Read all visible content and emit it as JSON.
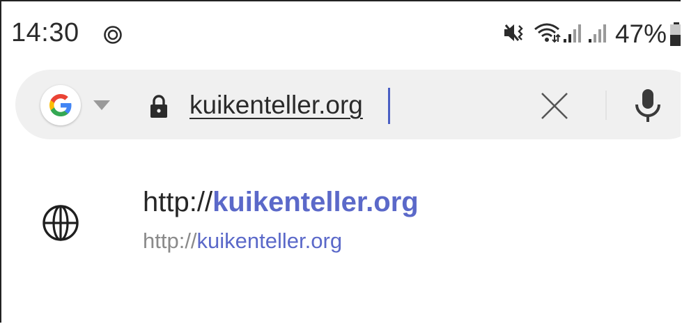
{
  "status_bar": {
    "time": "14:30",
    "battery_percent": "47%",
    "icons": [
      "sync-icon",
      "mute-vibrate-icon",
      "wifi-icon",
      "signal-icon",
      "signal-icon-2",
      "battery-icon"
    ]
  },
  "omnibox": {
    "search_engine_icon": "google-g-icon",
    "secure": true,
    "url_value": "kuikenteller.org",
    "actions": [
      "clear-icon",
      "mic-icon"
    ]
  },
  "suggestions": [
    {
      "icon": "globe-icon",
      "title_prefix": "http://",
      "title_highlight": "kuikenteller.org",
      "subtitle_prefix": "http://",
      "subtitle_highlight": "kuikenteller.org"
    }
  ],
  "colors": {
    "omnibox_bg": "#f0f0f0",
    "highlight": "#5b69c9",
    "cursor": "#4a5fc4",
    "muted_text": "#8a8a8a"
  }
}
